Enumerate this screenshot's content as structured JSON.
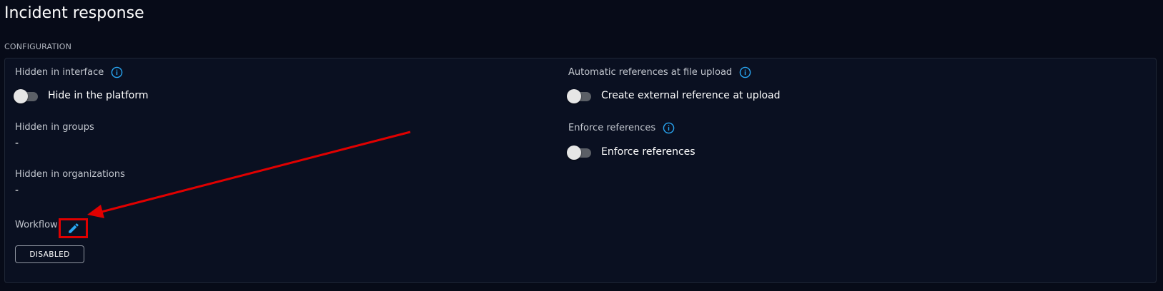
{
  "page": {
    "title": "Incident response",
    "section": "CONFIGURATION"
  },
  "left": {
    "hidden_interface": {
      "label": "Hidden in interface",
      "toggle_label": "Hide in the platform"
    },
    "hidden_groups": {
      "label": "Hidden in groups",
      "value": "-"
    },
    "hidden_orgs": {
      "label": "Hidden in organizations",
      "value": "-"
    },
    "workflow": {
      "label": "Workflow",
      "status": "DISABLED"
    }
  },
  "right": {
    "auto_refs": {
      "label": "Automatic references at file upload",
      "toggle_label": "Create external reference at upload"
    },
    "enforce_refs": {
      "label": "Enforce references",
      "toggle_label": "Enforce references"
    }
  },
  "icons": {
    "info": "info-circle-icon",
    "edit": "pencil-icon"
  },
  "colors": {
    "accent": "#29a6f2",
    "annotation": "#e00000",
    "background": "#070b18",
    "panel": "#0a1021"
  }
}
